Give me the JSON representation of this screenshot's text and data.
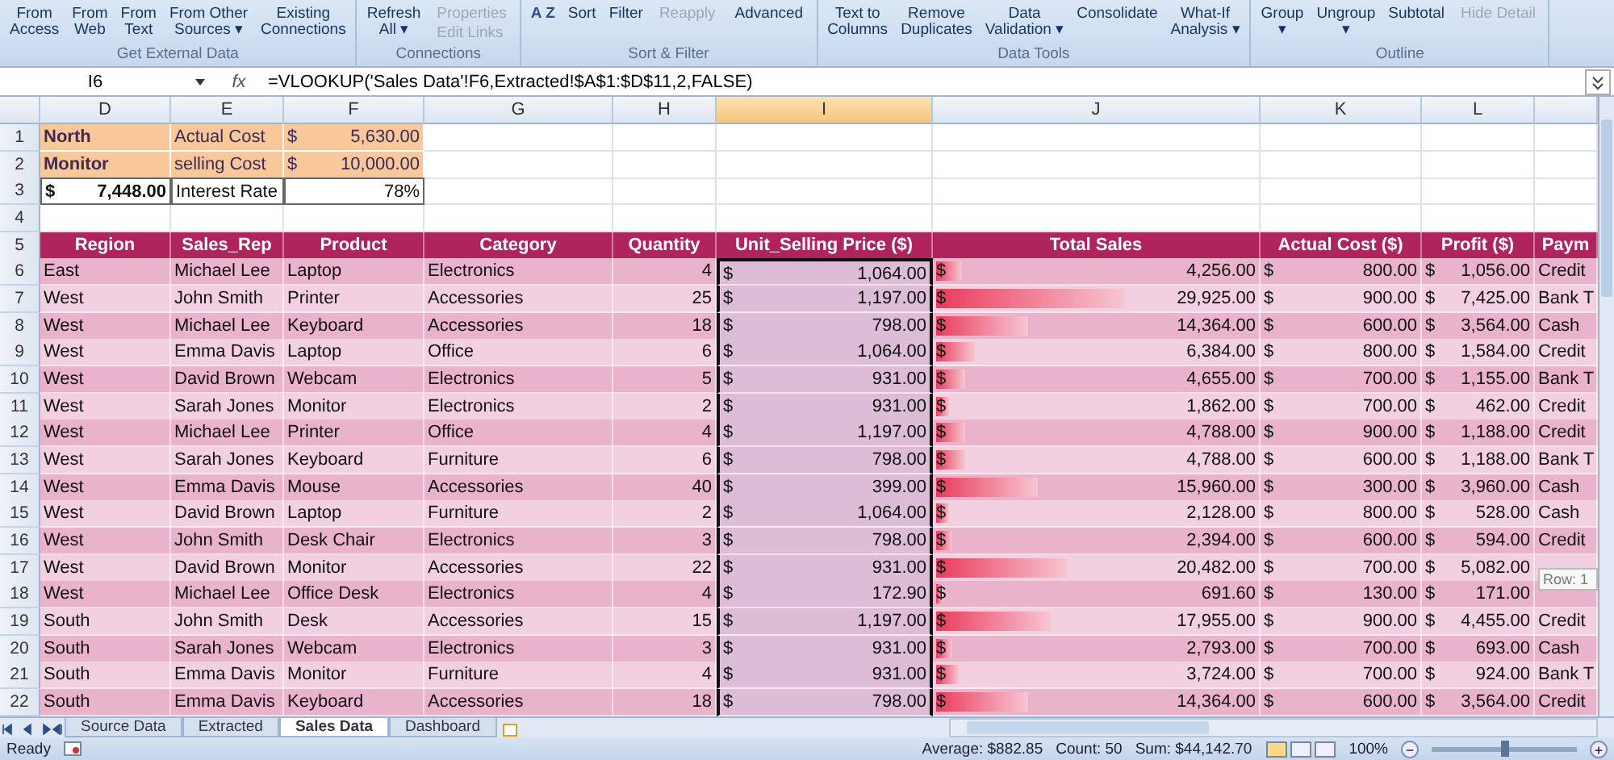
{
  "ribbon": {
    "groups": [
      {
        "label": "Get External Data",
        "buttons": [
          {
            "kind": "large",
            "lines": [
              "From",
              "Access"
            ]
          },
          {
            "kind": "large",
            "lines": [
              "From",
              "Web"
            ]
          },
          {
            "kind": "large",
            "lines": [
              "From",
              "Text"
            ]
          },
          {
            "kind": "large",
            "lines": [
              "From Other",
              "Sources ▾"
            ]
          },
          {
            "kind": "large",
            "lines": [
              "Existing",
              "Connections"
            ]
          }
        ]
      },
      {
        "label": "Connections",
        "buttons": [
          {
            "kind": "large",
            "lines": [
              "Refresh",
              "All ▾"
            ]
          },
          {
            "kind": "small",
            "lines": [
              "Properties",
              "Edit Links"
            ],
            "disabled": true
          }
        ]
      },
      {
        "label": "Sort & Filter",
        "buttons": [
          {
            "kind": "icon",
            "lines": [
              "A Z"
            ]
          },
          {
            "kind": "large",
            "lines": [
              "Sort"
            ]
          },
          {
            "kind": "large",
            "lines": [
              "Filter"
            ]
          },
          {
            "kind": "small",
            "lines": [
              "Reapply"
            ],
            "disabled": true
          },
          {
            "kind": "small",
            "lines": [
              "Advanced"
            ],
            "disabled": false
          }
        ]
      },
      {
        "label": "Data Tools",
        "buttons": [
          {
            "kind": "large",
            "lines": [
              "Text to",
              "Columns"
            ]
          },
          {
            "kind": "large",
            "lines": [
              "Remove",
              "Duplicates"
            ]
          },
          {
            "kind": "large",
            "lines": [
              "Data",
              "Validation ▾"
            ]
          },
          {
            "kind": "large",
            "lines": [
              "Consolidate"
            ]
          },
          {
            "kind": "large",
            "lines": [
              "What-If",
              "Analysis ▾"
            ]
          }
        ]
      },
      {
        "label": "Outline",
        "buttons": [
          {
            "kind": "large",
            "lines": [
              "Group",
              "▾"
            ]
          },
          {
            "kind": "large",
            "lines": [
              "Ungroup",
              "▾"
            ]
          },
          {
            "kind": "large",
            "lines": [
              "Subtotal"
            ]
          },
          {
            "kind": "small",
            "lines": [
              "Hide Detail"
            ],
            "disabled": true
          }
        ]
      }
    ]
  },
  "formula_bar": {
    "name_box": "I6",
    "fx": "fx",
    "formula": "=VLOOKUP('Sales Data'!F6,Extracted!$A$1:$D$11,2,FALSE)"
  },
  "column_headers": [
    {
      "label": "D",
      "selected": false
    },
    {
      "label": "E",
      "selected": false
    },
    {
      "label": "F",
      "selected": false
    },
    {
      "label": "G",
      "selected": false
    },
    {
      "label": "H",
      "selected": false
    },
    {
      "label": "I",
      "selected": true
    },
    {
      "label": "J",
      "selected": false
    },
    {
      "label": "K",
      "selected": false
    },
    {
      "label": "L",
      "selected": false
    }
  ],
  "top_rows": [
    {
      "n": "1",
      "cells": [
        {
          "kind": "text",
          "text": "North",
          "highlight": true,
          "bold": true
        },
        {
          "kind": "text",
          "text": "Actual Cost",
          "highlight": true,
          "bold": false
        },
        {
          "kind": "money",
          "sym": "$",
          "num": "5,630.00",
          "highlight": true
        }
      ]
    },
    {
      "n": "2",
      "cells": [
        {
          "kind": "text",
          "text": "Monitor",
          "highlight": true,
          "bold": true
        },
        {
          "kind": "text",
          "text": "selling Cost",
          "highlight": true,
          "bold": false
        },
        {
          "kind": "money",
          "sym": "$",
          "num": "10,000.00",
          "highlight": true
        }
      ]
    },
    {
      "n": "3",
      "cells": [
        {
          "kind": "money",
          "sym": "$",
          "num": "7,448.00",
          "highlight": false,
          "bold": true
        },
        {
          "kind": "text",
          "text": "Interest Rate",
          "highlight": false,
          "bold": false
        },
        {
          "kind": "number",
          "text": "78%",
          "highlight": false
        }
      ]
    },
    {
      "n": "4",
      "cells": []
    }
  ],
  "table": {
    "n": "5",
    "columns": [
      "Region",
      "Sales_Rep",
      "Product",
      "Category",
      "Quantity",
      "Unit_Selling Price ($)",
      "Total Sales",
      "Actual Cost ($)",
      "Profit ($)",
      "Paym"
    ],
    "rows": [
      {
        "n": "6",
        "region": "East",
        "rep": "Michael Lee",
        "product": "Laptop",
        "category": "Electronics",
        "qty": "4",
        "price": [
          "$",
          "1,064.00"
        ],
        "total": [
          "$",
          "4,256.00"
        ],
        "level": 0.08,
        "cost": [
          "$",
          "800.00"
        ],
        "profit": [
          "$",
          "1,056.00"
        ],
        "payment": "Credit"
      },
      {
        "n": "7",
        "region": "West",
        "rep": "John Smith",
        "product": "Printer",
        "category": "Accessories",
        "qty": "25",
        "price": [
          "$",
          "1,197.00"
        ],
        "total": [
          "$",
          "29,925.00"
        ],
        "level": 0.58,
        "cost": [
          "$",
          "900.00"
        ],
        "profit": [
          "$",
          "7,425.00"
        ],
        "payment": "Bank T"
      },
      {
        "n": "8",
        "region": "West",
        "rep": "Michael Lee",
        "product": "Keyboard",
        "category": "Accessories",
        "qty": "18",
        "price": [
          "$",
          "798.00"
        ],
        "total": [
          "$",
          "14,364.00"
        ],
        "level": 0.28,
        "cost": [
          "$",
          "600.00"
        ],
        "profit": [
          "$",
          "3,564.00"
        ],
        "payment": "Cash"
      },
      {
        "n": "9",
        "region": "West",
        "rep": "Emma Davis",
        "product": "Laptop",
        "category": "Office",
        "qty": "6",
        "price": [
          "$",
          "1,064.00"
        ],
        "total": [
          "$",
          "6,384.00"
        ],
        "level": 0.12,
        "cost": [
          "$",
          "800.00"
        ],
        "profit": [
          "$",
          "1,584.00"
        ],
        "payment": "Credit"
      },
      {
        "n": "10",
        "region": "West",
        "rep": "David Brown",
        "product": "Webcam",
        "category": "Electronics",
        "qty": "5",
        "price": [
          "$",
          "931.00"
        ],
        "total": [
          "$",
          "4,655.00"
        ],
        "level": 0.09,
        "cost": [
          "$",
          "700.00"
        ],
        "profit": [
          "$",
          "1,155.00"
        ],
        "payment": "Bank T"
      },
      {
        "n": "11",
        "region": "West",
        "rep": "Sarah Jones",
        "product": "Monitor",
        "category": "Electronics",
        "qty": "2",
        "price": [
          "$",
          "931.00"
        ],
        "total": [
          "$",
          "1,862.00"
        ],
        "level": 0.04,
        "cost": [
          "$",
          "700.00"
        ],
        "profit": [
          "$",
          "462.00"
        ],
        "payment": "Credit"
      },
      {
        "n": "12",
        "region": "West",
        "rep": "Michael Lee",
        "product": "Printer",
        "category": "Office",
        "qty": "4",
        "price": [
          "$",
          "1,197.00"
        ],
        "total": [
          "$",
          "4,788.00"
        ],
        "level": 0.09,
        "cost": [
          "$",
          "900.00"
        ],
        "profit": [
          "$",
          "1,188.00"
        ],
        "payment": "Credit"
      },
      {
        "n": "13",
        "region": "West",
        "rep": "Sarah Jones",
        "product": "Keyboard",
        "category": "Furniture",
        "qty": "6",
        "price": [
          "$",
          "798.00"
        ],
        "total": [
          "$",
          "4,788.00"
        ],
        "level": 0.09,
        "cost": [
          "$",
          "600.00"
        ],
        "profit": [
          "$",
          "1,188.00"
        ],
        "payment": "Bank T"
      },
      {
        "n": "14",
        "region": "West",
        "rep": "Emma Davis",
        "product": "Mouse",
        "category": "Accessories",
        "qty": "40",
        "price": [
          "$",
          "399.00"
        ],
        "total": [
          "$",
          "15,960.00"
        ],
        "level": 0.31,
        "cost": [
          "$",
          "300.00"
        ],
        "profit": [
          "$",
          "3,960.00"
        ],
        "payment": "Cash"
      },
      {
        "n": "15",
        "region": "West",
        "rep": "David Brown",
        "product": "Laptop",
        "category": "Furniture",
        "qty": "2",
        "price": [
          "$",
          "1,064.00"
        ],
        "total": [
          "$",
          "2,128.00"
        ],
        "level": 0.04,
        "cost": [
          "$",
          "800.00"
        ],
        "profit": [
          "$",
          "528.00"
        ],
        "payment": "Cash"
      },
      {
        "n": "16",
        "region": "West",
        "rep": "John Smith",
        "product": "Desk Chair",
        "category": "Electronics",
        "qty": "3",
        "price": [
          "$",
          "798.00"
        ],
        "total": [
          "$",
          "2,394.00"
        ],
        "level": 0.05,
        "cost": [
          "$",
          "600.00"
        ],
        "profit": [
          "$",
          "594.00"
        ],
        "payment": "Credit"
      },
      {
        "n": "17",
        "region": "West",
        "rep": "David Brown",
        "product": "Monitor",
        "category": "Accessories",
        "qty": "22",
        "price": [
          "$",
          "931.00"
        ],
        "total": [
          "$",
          "20,482.00"
        ],
        "level": 0.4,
        "cost": [
          "$",
          "700.00"
        ],
        "profit": [
          "$",
          "5,082.00"
        ]
      },
      {
        "n": "18",
        "region": "West",
        "rep": "Michael Lee",
        "product": "Office Desk",
        "category": "Electronics",
        "qty": "4",
        "price": [
          "$",
          "172.90"
        ],
        "total": [
          "$",
          "691.60"
        ],
        "level": 0.02,
        "cost": [
          "$",
          "130.00"
        ],
        "profit": [
          "$",
          "171.00"
        ]
      },
      {
        "n": "19",
        "region": "South",
        "rep": "John Smith",
        "product": "Desk",
        "category": "Accessories",
        "qty": "15",
        "price": [
          "$",
          "1,197.00"
        ],
        "total": [
          "$",
          "17,955.00"
        ],
        "level": 0.35,
        "cost": [
          "$",
          "900.00"
        ],
        "profit": [
          "$",
          "4,455.00"
        ],
        "payment": "Credit"
      },
      {
        "n": "20",
        "region": "South",
        "rep": "Sarah Jones",
        "product": "Webcam",
        "category": "Electronics",
        "qty": "3",
        "price": [
          "$",
          "931.00"
        ],
        "total": [
          "$",
          "2,793.00"
        ],
        "level": 0.05,
        "cost": [
          "$",
          "700.00"
        ],
        "profit": [
          "$",
          "693.00"
        ],
        "payment": "Cash"
      },
      {
        "n": "21",
        "region": "South",
        "rep": "Emma Davis",
        "product": "Monitor",
        "category": "Furniture",
        "qty": "4",
        "price": [
          "$",
          "931.00"
        ],
        "total": [
          "$",
          "3,724.00"
        ],
        "level": 0.07,
        "cost": [
          "$",
          "700.00"
        ],
        "profit": [
          "$",
          "924.00"
        ],
        "payment": "Bank T"
      },
      {
        "n": "22",
        "region": "South",
        "rep": "Emma Davis",
        "product": "Keyboard",
        "category": "Accessories",
        "qty": "18",
        "price": [
          "$",
          "798.00"
        ],
        "total": [
          "$",
          "14,364.00"
        ],
        "level": 0.28,
        "cost": [
          "$",
          "600.00"
        ],
        "profit": [
          "$",
          "3,564.00"
        ],
        "payment": "Credit"
      }
    ]
  },
  "tooltip": "Row: 1",
  "sheet_tabs": [
    {
      "label": "Source Data",
      "selected": false
    },
    {
      "label": "Extracted",
      "selected": false
    },
    {
      "label": "Sales Data",
      "selected": true
    },
    {
      "label": "Dashboard",
      "selected": false
    }
  ],
  "status_bar": {
    "state": "Ready",
    "average": "Average: $882.85",
    "count": "Count: 50",
    "sum": "Sum: $44,142.70",
    "zoom": "100%",
    "zoom_minus": "−",
    "zoom_plus": "+",
    "zoom_level": {
      "level": 0.5
    }
  }
}
